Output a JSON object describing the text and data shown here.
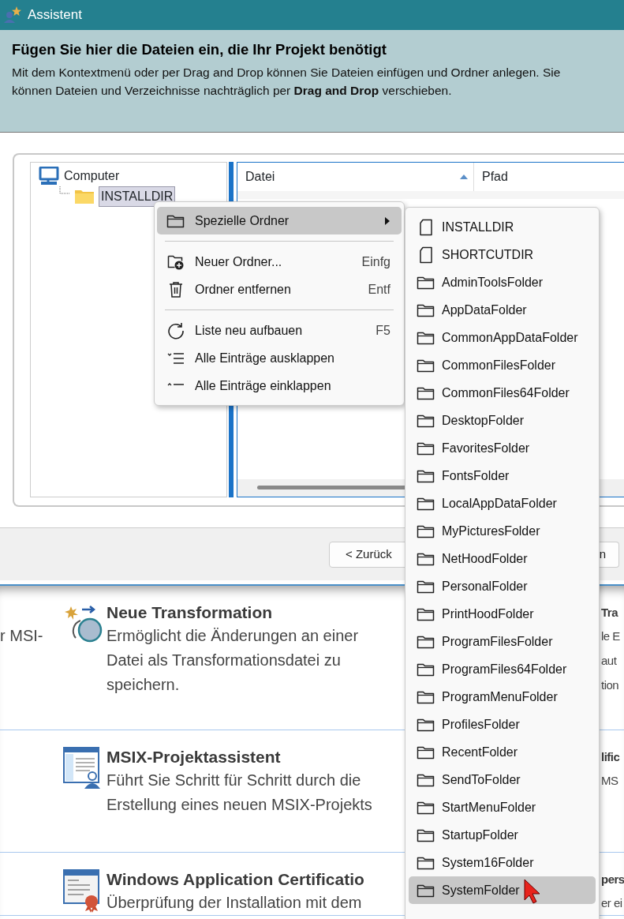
{
  "window": {
    "title": "Assistent"
  },
  "header": {
    "title": "Fügen Sie hier die Dateien ein, die Ihr Projekt benötigt",
    "text": "Mit dem Kontextmenü oder per Drag and Drop können Sie Dateien einfügen und Ordner anlegen. Sie können Dateien und Verzeichnisse nachträglich per **Drag and Drop** verschieben."
  },
  "tree": [
    {
      "label": "Computer",
      "kind": "computer",
      "selected": false,
      "children": [
        {
          "label": "INSTALLDIR",
          "kind": "folder",
          "selected": true
        }
      ]
    }
  ],
  "file_list": {
    "columns": [
      {
        "label": "Datei",
        "sorted": true
      },
      {
        "label": "Pfad",
        "sorted": false
      }
    ]
  },
  "buttons": [
    {
      "label": "< Zurück"
    },
    {
      "label": "n"
    }
  ],
  "context_menu": {
    "groups": [
      [
        {
          "label": "Spezielle Ordner",
          "kind": "folder",
          "selected": true,
          "submenu": true
        }
      ],
      [
        {
          "label": "Neuer Ordner...",
          "kind": "new-folder",
          "shortcut": "Einfg",
          "selected": false,
          "submenu": false
        },
        {
          "label": "Ordner entfernen",
          "kind": "delete",
          "shortcut": "Entf",
          "selected": false,
          "submenu": false
        }
      ],
      [
        {
          "label": "Liste neu aufbauen",
          "kind": "refresh",
          "shortcut": "F5",
          "selected": false,
          "submenu": false
        },
        {
          "label": "Alle Einträge ausklappen",
          "kind": "expand",
          "selected": false,
          "submenu": false
        },
        {
          "label": "Alle Einträge einklappen",
          "kind": "collapse",
          "selected": false,
          "submenu": false
        }
      ]
    ]
  },
  "submenu": {
    "items": [
      {
        "label": "INSTALLDIR",
        "kind": "file",
        "selected": false
      },
      {
        "label": "SHORTCUTDIR",
        "kind": "file",
        "selected": false
      },
      {
        "label": "AdminToolsFolder",
        "kind": "folder",
        "selected": false
      },
      {
        "label": "AppDataFolder",
        "kind": "folder",
        "selected": false
      },
      {
        "label": "CommonAppDataFolder",
        "kind": "folder",
        "selected": false
      },
      {
        "label": "CommonFilesFolder",
        "kind": "folder",
        "selected": false
      },
      {
        "label": "CommonFiles64Folder",
        "kind": "folder",
        "selected": false
      },
      {
        "label": "DesktopFolder",
        "kind": "folder",
        "selected": false
      },
      {
        "label": "FavoritesFolder",
        "kind": "folder",
        "selected": false
      },
      {
        "label": "FontsFolder",
        "kind": "folder",
        "selected": false
      },
      {
        "label": "LocalAppDataFolder",
        "kind": "folder",
        "selected": false
      },
      {
        "label": "MyPicturesFolder",
        "kind": "folder",
        "selected": false
      },
      {
        "label": "NetHoodFolder",
        "kind": "folder",
        "selected": false
      },
      {
        "label": "PersonalFolder",
        "kind": "folder",
        "selected": false
      },
      {
        "label": "PrintHoodFolder",
        "kind": "folder",
        "selected": false
      },
      {
        "label": "ProgramFilesFolder",
        "kind": "folder",
        "selected": false
      },
      {
        "label": "ProgramFiles64Folder",
        "kind": "folder",
        "selected": false
      },
      {
        "label": "ProgramMenuFolder",
        "kind": "folder",
        "selected": false
      },
      {
        "label": "ProfilesFolder",
        "kind": "folder",
        "selected": false
      },
      {
        "label": "RecentFolder",
        "kind": "folder",
        "selected": false
      },
      {
        "label": "SendToFolder",
        "kind": "folder",
        "selected": false
      },
      {
        "label": "StartMenuFolder",
        "kind": "folder",
        "selected": false
      },
      {
        "label": "StartupFolder",
        "kind": "folder",
        "selected": false
      },
      {
        "label": "System16Folder",
        "kind": "folder",
        "selected": false
      },
      {
        "label": "SystemFolder",
        "kind": "folder",
        "selected": true
      }
    ]
  },
  "background": {
    "rows": [
      {
        "left": [
          "r MSI-"
        ],
        "kind": "transform",
        "title": "Neue Transformation",
        "description": "Ermöglicht die Änderungen an einer Datei als Transformationsdatei zu speichern.",
        "right_title": "Tra",
        "right": [
          "le E",
          "aut",
          "tion"
        ]
      },
      {
        "left": [],
        "kind": "msix",
        "title": "MSIX-Projektassistent",
        "description": "Führt Sie Schritt für Schritt durch die Erstellung eines neuen MSIX-Projekts",
        "right_title": "lific",
        "right": [
          "MS"
        ]
      },
      {
        "left": [],
        "kind": "certificate",
        "title": "Windows Application Certificatio",
        "description": "Überprüfung der Installation mit dem",
        "right_title": "pers",
        "right": [
          "er ei"
        ]
      }
    ]
  }
}
